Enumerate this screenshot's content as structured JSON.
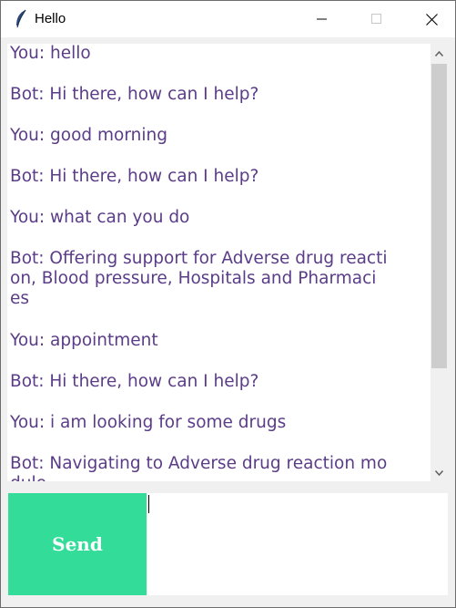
{
  "window": {
    "title": "Hello",
    "app_icon": "feather-icon",
    "controls": [
      "minimize-icon",
      "maximize-icon",
      "close-icon"
    ]
  },
  "chat": {
    "messages": [
      "You: hello",
      "Bot: Hi there, how can I help?",
      "You: good morning",
      "Bot: Hi there, how can I help?",
      "You: what can you do",
      "Bot: Offering support for Adverse drug reacti\non, Blood pressure, Hospitals and Pharmaci\nes",
      "You: appointment",
      "Bot: Hi there, how can I help?",
      "You: i am looking for some drugs",
      "Bot: Navigating to Adverse drug reaction mo\ndule"
    ],
    "text_color": "#5b3c88"
  },
  "input": {
    "send_label": "Send",
    "value": "",
    "send_color": "#33dd99"
  }
}
